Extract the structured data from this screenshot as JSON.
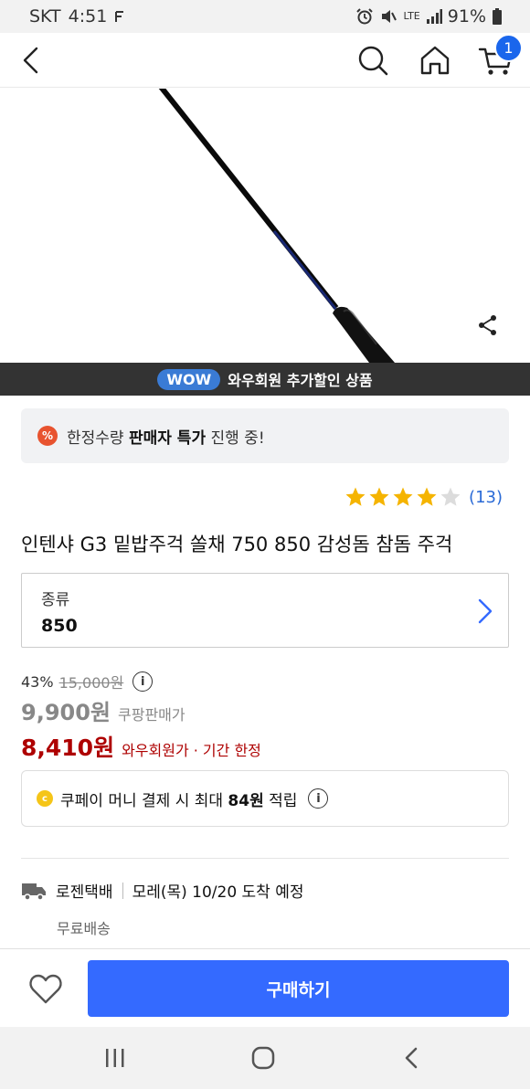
{
  "status_bar": {
    "carrier": "SKT",
    "time": "4:51",
    "signal_type": "LTE",
    "battery": "91%"
  },
  "header": {
    "cart_count": "1"
  },
  "wow_banner": {
    "pill": "WOW",
    "text": "와우회원 추가할인 상품"
  },
  "notice": {
    "icon": "%",
    "prefix": "한정수량 ",
    "highlight": "판매자 특가",
    "suffix": " 진행 중!"
  },
  "rating": {
    "stars": 4,
    "max_stars": 5,
    "count": "(13)"
  },
  "product": {
    "title": "인텐샤 G3 밑밥주걱 쏠채 750 850 감성돔 참돔 주걱"
  },
  "option": {
    "label": "종류",
    "value": "850"
  },
  "pricing": {
    "discount": "43%",
    "original": "15,000원",
    "coupang_price": "9,900원",
    "coupang_label": "쿠팡판매가",
    "wow_price": "8,410원",
    "wow_label": "와우회원가 · 기간 한정",
    "info": "i"
  },
  "cashback": {
    "coin": "c",
    "prefix": "쿠페이 머니 결제 시 최대 ",
    "amount": "84원",
    "suffix": " 적립",
    "info": "i"
  },
  "shipping": {
    "carrier": "로젠택배",
    "arrival": "모레(목) 10/20 도착 예정",
    "fee": "무료배송"
  },
  "actions": {
    "buy_label": "구매하기"
  },
  "colors": {
    "accent_blue": "#346aff",
    "wow_red": "#ae0000",
    "star_yellow": "#f5b400"
  }
}
